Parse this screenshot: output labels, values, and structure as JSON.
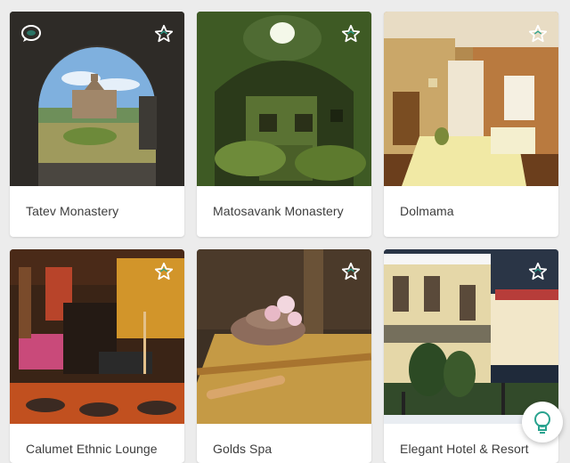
{
  "places": [
    {
      "name": "Tatev Monastery"
    },
    {
      "name": "Matosavank Monastery"
    },
    {
      "name": "Dolmama"
    },
    {
      "name": "Calumet Ethnic Lounge"
    },
    {
      "name": "Golds Spa"
    },
    {
      "name": "Elegant Hotel & Resort"
    }
  ],
  "icons": {
    "favorite": "star-outline-icon",
    "comment": "chat-bubble-icon",
    "assistant": "lightbulb-icon"
  },
  "colors": {
    "background": "#ececec",
    "card": "#ffffff",
    "title_text": "#3d3d3d",
    "accent_teal": "#2aa38f"
  }
}
